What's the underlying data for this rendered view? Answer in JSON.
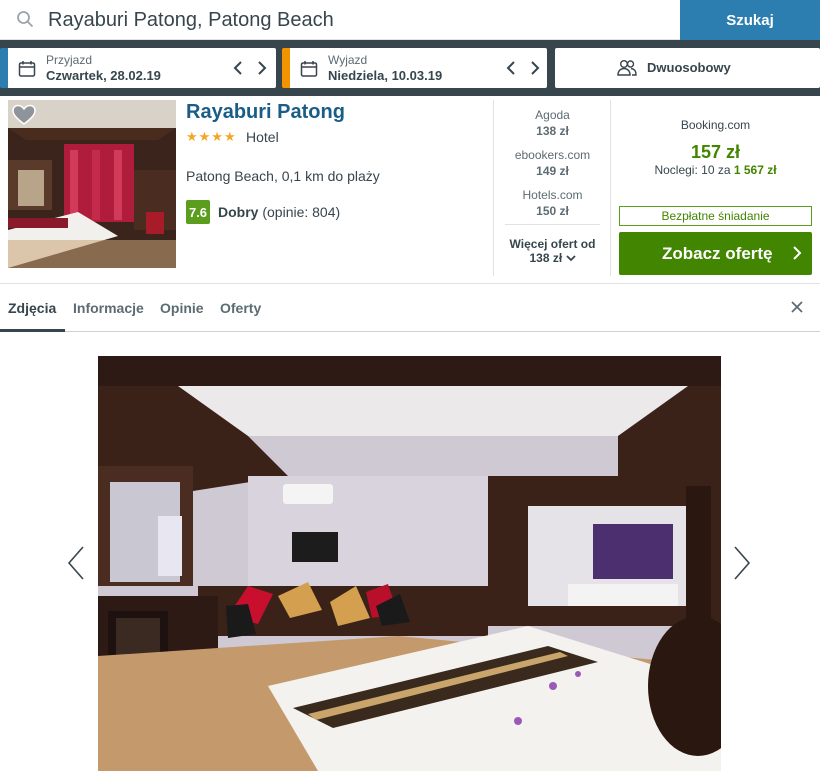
{
  "search": {
    "query": "Rayaburi Patong, Patong Beach",
    "button_label": "Szukaj"
  },
  "dates": {
    "checkin_label": "Przyjazd",
    "checkin_value": "Czwartek, 28.02.19",
    "checkout_label": "Wyjazd",
    "checkout_value": "Niedziela, 10.03.19",
    "guests_label": "Dwuosobowy"
  },
  "hotel": {
    "name": "Rayaburi Patong",
    "stars": "★★★★",
    "star_count": 4,
    "type": "Hotel",
    "location": "Patong Beach, 0,1 km do plaży",
    "rating_score": "7.6",
    "rating_word": "Dobry",
    "rating_reviews": "(opinie: 804)"
  },
  "offers": [
    {
      "site": "Agoda",
      "price": "138 zł"
    },
    {
      "site": "ebookers.com",
      "price": "149 zł"
    },
    {
      "site": "Hotels.com",
      "price": "150 zł"
    }
  ],
  "more_offers": {
    "label": "Więcej ofert od",
    "price": "138 zł"
  },
  "best_offer": {
    "site": "Booking.com",
    "price": "157 zł",
    "nights_prefix": "Noclegi: 10 za",
    "nights_total": "1 567 zł",
    "badge": "Bezpłatne śniadanie",
    "cta_label": "Zobacz ofertę"
  },
  "tabs": [
    "Zdjęcia",
    "Informacje",
    "Opinie",
    "Oferty"
  ],
  "colors": {
    "brand_blue": "#2c7eb0",
    "dark_bar": "#37454d",
    "checkout_accent": "#f29400",
    "green": "#428500",
    "star": "#f5a623"
  }
}
